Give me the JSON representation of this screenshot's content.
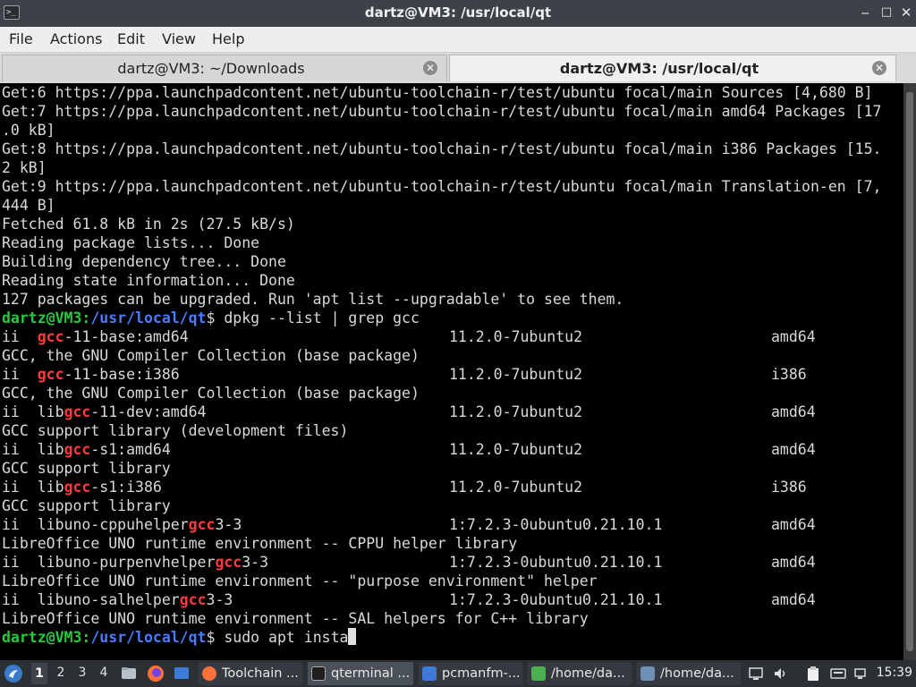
{
  "window": {
    "title": "dartz@VM3: /usr/local/qt",
    "app_icon_glyph": ">_",
    "min_glyph": "‒",
    "max_glyph": "□",
    "close_glyph": "✕"
  },
  "menubar": [
    "File",
    "Actions",
    "Edit",
    "View",
    "Help"
  ],
  "tabs": [
    {
      "label": "dartz@VM3: ~/Downloads",
      "active": false
    },
    {
      "label": "dartz@VM3: /usr/local/qt",
      "active": true
    }
  ],
  "terminal": {
    "colors": {
      "prompt_user": "#27c93f",
      "prompt_path": "#4b7bff",
      "match": "#ff3a3a",
      "text": "#d9d9d9"
    },
    "lines": [
      {
        "t": "Get:6 https://ppa.launchpadcontent.net/ubuntu-toolchain-r/test/ubuntu focal/main Sources [4,680 B]"
      },
      {
        "t": "Get:7 https://ppa.launchpadcontent.net/ubuntu-toolchain-r/test/ubuntu focal/main amd64 Packages [17"
      },
      {
        "t": ".0 kB]"
      },
      {
        "t": "Get:8 https://ppa.launchpadcontent.net/ubuntu-toolchain-r/test/ubuntu focal/main i386 Packages [15."
      },
      {
        "t": "2 kB]"
      },
      {
        "t": "Get:9 https://ppa.launchpadcontent.net/ubuntu-toolchain-r/test/ubuntu focal/main Translation-en [7,"
      },
      {
        "t": "444 B]"
      },
      {
        "t": "Fetched 61.8 kB in 2s (27.5 kB/s)"
      },
      {
        "t": "Reading package lists... Done"
      },
      {
        "t": "Building dependency tree... Done"
      },
      {
        "t": "Reading state information... Done"
      },
      {
        "t": "127 packages can be upgraded. Run 'apt list --upgradable' to see them."
      },
      {
        "prompt": {
          "user": "dartz@VM3",
          "sep": ":",
          "path": "/usr/local/qt",
          "end": "$ ",
          "cmd": "dpkg --list | grep gcc"
        }
      },
      {
        "pkg": {
          "state": "ii",
          "pre": "",
          "match": "gcc",
          "post": "-11-base:amd64",
          "version": "11.2.0-7ubuntu2",
          "arch": "amd64"
        }
      },
      {
        "t": "GCC, the GNU Compiler Collection (base package)"
      },
      {
        "pkg": {
          "state": "ii",
          "pre": "",
          "match": "gcc",
          "post": "-11-base:i386",
          "version": "11.2.0-7ubuntu2",
          "arch": "i386"
        }
      },
      {
        "t": "GCC, the GNU Compiler Collection (base package)"
      },
      {
        "pkg": {
          "state": "ii",
          "pre": "lib",
          "match": "gcc",
          "post": "-11-dev:amd64",
          "version": "11.2.0-7ubuntu2",
          "arch": "amd64"
        }
      },
      {
        "t": "GCC support library (development files)"
      },
      {
        "pkg": {
          "state": "ii",
          "pre": "lib",
          "match": "gcc",
          "post": "-s1:amd64",
          "version": "11.2.0-7ubuntu2",
          "arch": "amd64"
        }
      },
      {
        "t": "GCC support library"
      },
      {
        "pkg": {
          "state": "ii",
          "pre": "lib",
          "match": "gcc",
          "post": "-s1:i386",
          "version": "11.2.0-7ubuntu2",
          "arch": "i386"
        }
      },
      {
        "t": "GCC support library"
      },
      {
        "pkg": {
          "state": "ii",
          "pre": "libuno-cppuhelper",
          "match": "gcc",
          "post": "3-3",
          "version": "1:7.2.3-0ubuntu0.21.10.1",
          "arch": "amd64"
        }
      },
      {
        "t": "LibreOffice UNO runtime environment -- CPPU helper library"
      },
      {
        "pkg": {
          "state": "ii",
          "pre": "libuno-purpenvhelper",
          "match": "gcc",
          "post": "3-3",
          "version": "1:7.2.3-0ubuntu0.21.10.1",
          "arch": "amd64"
        }
      },
      {
        "t": "LibreOffice UNO runtime environment -- \"purpose environment\" helper"
      },
      {
        "pkg": {
          "state": "ii",
          "pre": "libuno-salhelper",
          "match": "gcc",
          "post": "3-3",
          "version": "1:7.2.3-0ubuntu0.21.10.1",
          "arch": "amd64"
        }
      },
      {
        "t": "LibreOffice UNO runtime environment -- SAL helpers for C++ library"
      },
      {
        "prompt": {
          "user": "dartz@VM3",
          "sep": ":",
          "path": "/usr/local/qt",
          "end": "$ ",
          "cmd": "sudo apt insta"
        },
        "cursor": true
      }
    ]
  },
  "taskbar": {
    "workspaces": [
      "1",
      "2",
      "3",
      "4"
    ],
    "active_workspace": 0,
    "tasks": [
      {
        "label": "Toolchain ...",
        "icon": "firefox-icon",
        "color": "#ff7139"
      },
      {
        "label": "qterminal ...",
        "icon": "terminal-icon",
        "color": "#1e1e1e",
        "active": true
      },
      {
        "label": "pcmanfm-...",
        "icon": "folder-icon",
        "color": "#3d7bd9"
      },
      {
        "label": "/home/da...",
        "icon": "text-editor-icon",
        "color": "#4caf50"
      },
      {
        "label": "/home/da...",
        "icon": "featherpad-icon",
        "color": "#6f8fb5"
      }
    ],
    "clock": "15:39"
  }
}
